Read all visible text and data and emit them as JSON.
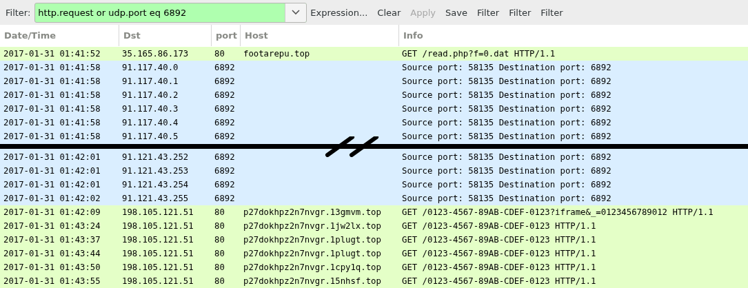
{
  "toolbar": {
    "label": "Filter:",
    "filter": {
      "value": "http.request or udp.port eq 6892",
      "valid": true
    },
    "buttons": [
      {
        "label": "Expression...",
        "disabled": false
      },
      {
        "label": "Clear",
        "disabled": false
      },
      {
        "label": "Apply",
        "disabled": true
      },
      {
        "label": "Save",
        "disabled": false
      },
      {
        "label": "Filter",
        "disabled": false
      },
      {
        "label": "Filter",
        "disabled": false
      },
      {
        "label": "Filter",
        "disabled": false
      }
    ]
  },
  "table": {
    "columns": [
      "Date/Time",
      "Dst",
      "port",
      "Host",
      "Info"
    ],
    "rows": [
      {
        "kind": "http",
        "cells": [
          "2017-01-31 01:41:52",
          "35.165.86.173",
          "80",
          "footarepu.top",
          "GET /read.php?f=0.dat HTTP/1.1"
        ]
      },
      {
        "kind": "udp",
        "cells": [
          "2017-01-31 01:41:58",
          "91.117.40.0",
          "6892",
          "",
          "Source port: 58135  Destination port: 6892"
        ]
      },
      {
        "kind": "udp",
        "cells": [
          "2017-01-31 01:41:58",
          "91.117.40.1",
          "6892",
          "",
          "Source port: 58135  Destination port: 6892"
        ]
      },
      {
        "kind": "udp",
        "cells": [
          "2017-01-31 01:41:58",
          "91.117.40.2",
          "6892",
          "",
          "Source port: 58135  Destination port: 6892"
        ]
      },
      {
        "kind": "udp",
        "cells": [
          "2017-01-31 01:41:58",
          "91.117.40.3",
          "6892",
          "",
          "Source port: 58135  Destination port: 6892"
        ]
      },
      {
        "kind": "udp",
        "cells": [
          "2017-01-31 01:41:58",
          "91.117.40.4",
          "6892",
          "",
          "Source port: 58135  Destination port: 6892"
        ]
      },
      {
        "kind": "udp",
        "cells": [
          "2017-01-31 01:41:58",
          "91.117.40.5",
          "6892",
          "",
          "Source port: 58135  Destination port: 6892"
        ]
      },
      {
        "kind": "break"
      },
      {
        "kind": "udp",
        "cells": [
          "2017-01-31 01:42:01",
          "91.121.43.252",
          "6892",
          "",
          "Source port: 58135  Destination port: 6892"
        ]
      },
      {
        "kind": "udp",
        "cells": [
          "2017-01-31 01:42:01",
          "91.121.43.253",
          "6892",
          "",
          "Source port: 58135  Destination port: 6892"
        ]
      },
      {
        "kind": "udp",
        "cells": [
          "2017-01-31 01:42:01",
          "91.121.43.254",
          "6892",
          "",
          "Source port: 58135  Destination port: 6892"
        ]
      },
      {
        "kind": "udp",
        "cells": [
          "2017-01-31 01:42:02",
          "91.121.43.255",
          "6892",
          "",
          "Source port: 58135  Destination port: 6892"
        ]
      },
      {
        "kind": "http",
        "cells": [
          "2017-01-31 01:42:09",
          "198.105.121.51",
          "80",
          "p27dokhpz2n7nvgr.13gmvm.top",
          "GET /0123-4567-89AB-CDEF-0123?iframe&_=0123456789012 HTTP/1.1"
        ]
      },
      {
        "kind": "http",
        "cells": [
          "2017-01-31 01:43:24",
          "198.105.121.51",
          "80",
          "p27dokhpz2n7nvgr.1jw2lx.top",
          "GET /0123-4567-89AB-CDEF-0123 HTTP/1.1"
        ]
      },
      {
        "kind": "http",
        "cells": [
          "2017-01-31 01:43:37",
          "198.105.121.51",
          "80",
          "p27dokhpz2n7nvgr.1plugt.top",
          "GET /0123-4567-89AB-CDEF-0123 HTTP/1.1"
        ]
      },
      {
        "kind": "http",
        "cells": [
          "2017-01-31 01:43:44",
          "198.105.121.51",
          "80",
          "p27dokhpz2n7nvgr.1plugt.top",
          "GET /0123-4567-89AB-CDEF-0123 HTTP/1.1"
        ]
      },
      {
        "kind": "http",
        "cells": [
          "2017-01-31 01:43:50",
          "198.105.121.51",
          "80",
          "p27dokhpz2n7nvgr.1cpy1q.top",
          "GET /0123-4567-89AB-CDEF-0123 HTTP/1.1"
        ]
      },
      {
        "kind": "http",
        "cells": [
          "2017-01-31 01:43:55",
          "198.105.121.51",
          "80",
          "p27dokhpz2n7nvgr.15nhsf.top",
          "GET /0123-4567-89AB-CDEF-0123 HTTP/1.1"
        ]
      }
    ]
  }
}
